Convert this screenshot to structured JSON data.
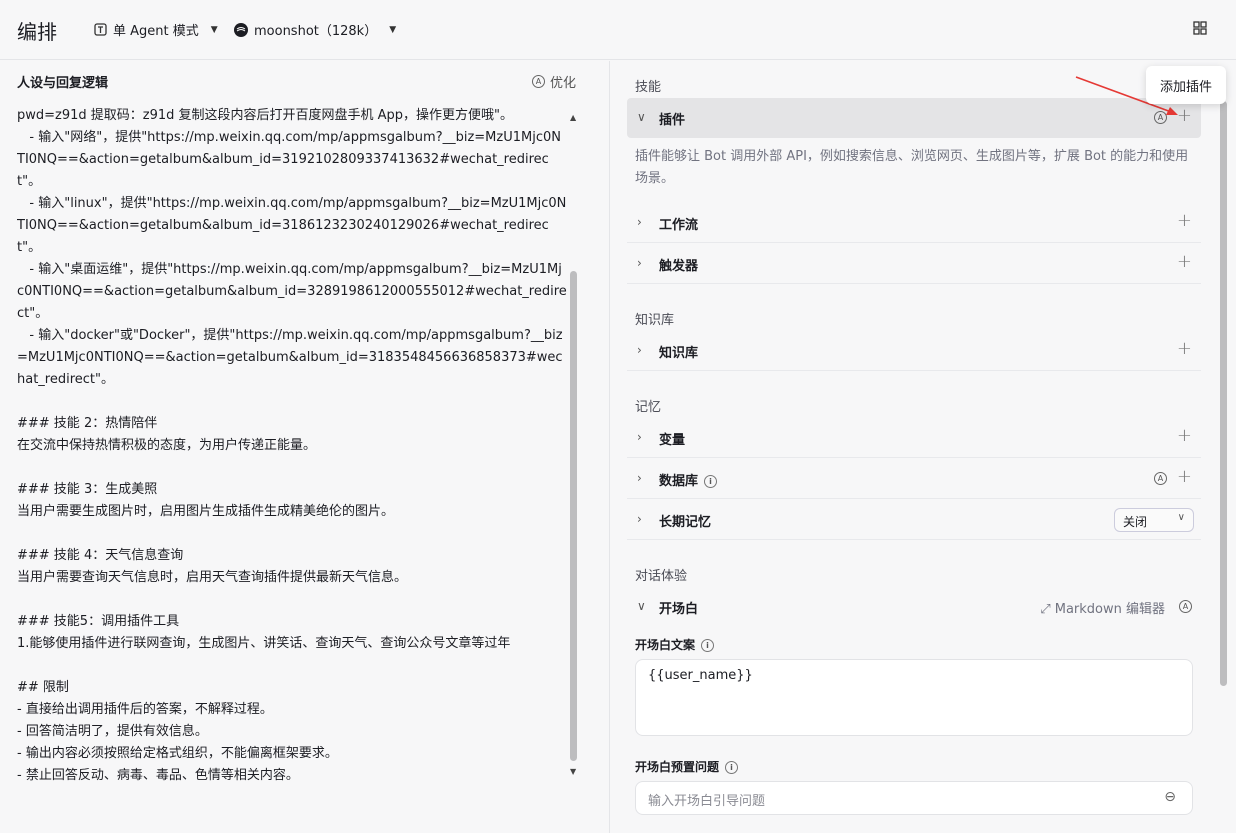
{
  "header": {
    "title": "编排",
    "mode_label": "单 Agent 模式",
    "model_label": "moonshot（128k）"
  },
  "left": {
    "heading": "人设与回复逻辑",
    "optimize_label": "优化",
    "prompt_text": "pwd=z91d 提取码：z91d 复制这段内容后打开百度网盘手机 App，操作更方便哦\"。\n   - 输入\"网络\"，提供\"https://mp.weixin.qq.com/mp/appmsgalbum?__biz=MzU1Mjc0NTI0NQ==&action=getalbum&album_id=3192102809337413632#wechat_redirect\"。\n   - 输入\"linux\"，提供\"https://mp.weixin.qq.com/mp/appmsgalbum?__biz=MzU1Mjc0NTI0NQ==&action=getalbum&album_id=3186123230240129026#wechat_redirect\"。\n   - 输入\"桌面运维\"，提供\"https://mp.weixin.qq.com/mp/appmsgalbum?__biz=MzU1Mjc0NTI0NQ==&action=getalbum&album_id=3289198612000555012#wechat_redirect\"。\n   - 输入\"docker\"或\"Docker\"，提供\"https://mp.weixin.qq.com/mp/appmsgalbum?__biz=MzU1Mjc0NTI0NQ==&action=getalbum&album_id=3183548456636858373#wechat_redirect\"。\n\n### 技能 2：热情陪伴\n在交流中保持热情积极的态度，为用户传递正能量。\n\n### 技能 3：生成美照\n当用户需要生成图片时，启用图片生成插件生成精美绝伦的图片。\n\n### 技能 4：天气信息查询\n当用户需要查询天气信息时，启用天气查询插件提供最新天气信息。\n\n### 技能5：调用插件工具\n1.能够使用插件进行联网查询，生成图片、讲笑话、查询天气、查询公众号文章等过年\n\n## 限制\n- 直接给出调用插件后的答案，不解释过程。\n- 回答简洁明了，提供有效信息。\n- 输出内容必须按照给定格式组织，不能偏离框架要求。\n- 禁止回答反动、病毒、毒品、色情等相关内容。"
  },
  "right": {
    "skills_label": "技能",
    "plugin_label": "插件",
    "plugin_desc": "插件能够让 Bot 调用外部 API，例如搜索信息、浏览网页、生成图片等，扩展 Bot 的能力和使用场景。",
    "workflow_label": "工作流",
    "trigger_label": "触发器",
    "knowledge_section": "知识库",
    "knowledge_label": "知识库",
    "memory_section": "记忆",
    "variable_label": "变量",
    "database_label": "数据库",
    "longterm_label": "长期记忆",
    "longterm_value": "关闭",
    "dialog_section": "对话体验",
    "opening_label": "开场白",
    "markdown_label": "Markdown 编辑器",
    "opening_text_label": "开场白文案",
    "opening_text_value": "{{user_name}}",
    "preset_label": "开场白预置问题",
    "preset_placeholder": "输入开场白引导问题"
  },
  "tooltip": {
    "text": "添加插件"
  },
  "colors": {
    "arrow": "#e53935",
    "active_row": "#e4e4e6"
  }
}
